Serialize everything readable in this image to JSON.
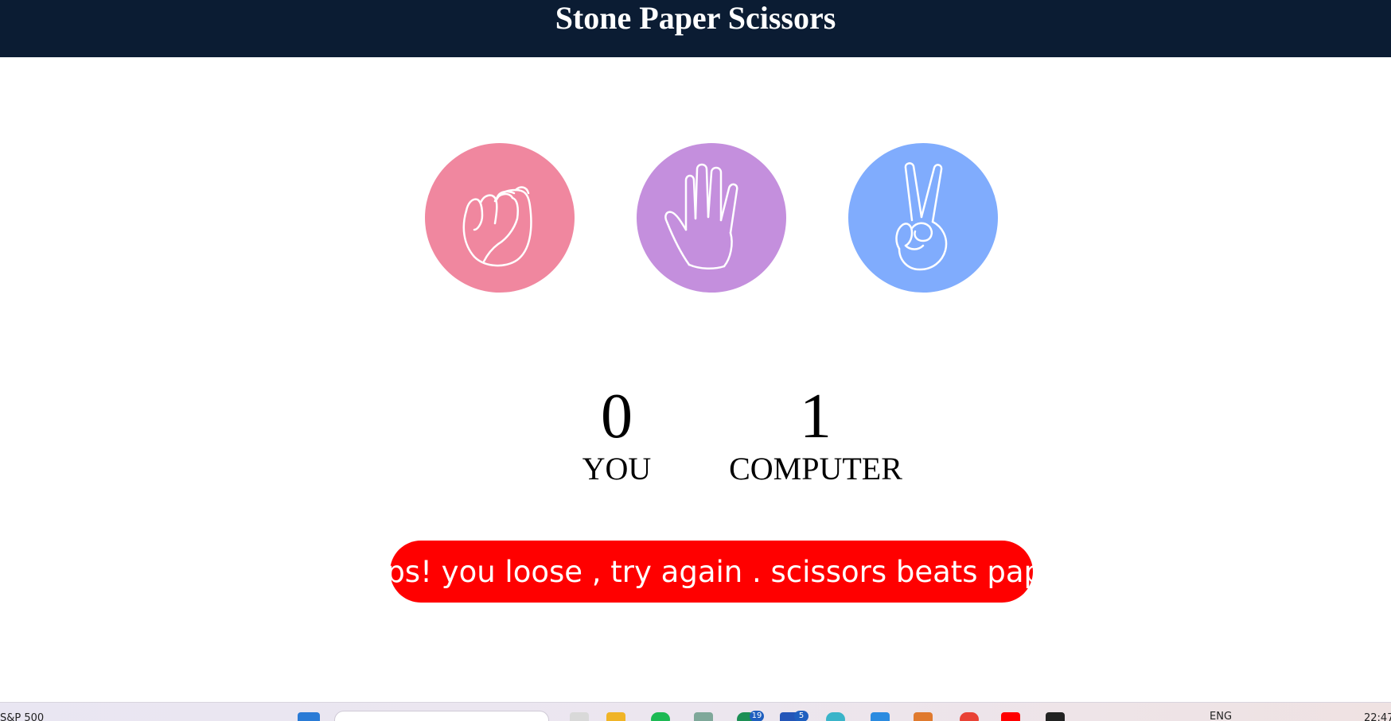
{
  "header": {
    "title": "Stone Paper Scissors"
  },
  "choices": [
    {
      "id": "rock",
      "icon": "rock-fist-icon",
      "color": "#f0879f"
    },
    {
      "id": "paper",
      "icon": "paper-hand-icon",
      "color": "#c48fdd"
    },
    {
      "id": "scissors",
      "icon": "scissors-hand-icon",
      "color": "#80acfd"
    }
  ],
  "scoreboard": {
    "user": {
      "score": "0",
      "label": "YOU"
    },
    "computer": {
      "score": "1",
      "label": "COMPUTER"
    }
  },
  "message": {
    "text": "oops! you loose , try again . scissors beats paper",
    "color": "#ff0000"
  },
  "taskbar": {
    "widget_text": "S&P 500",
    "language": "ENG",
    "time": "22:47",
    "badges": [
      "19",
      "5"
    ]
  }
}
